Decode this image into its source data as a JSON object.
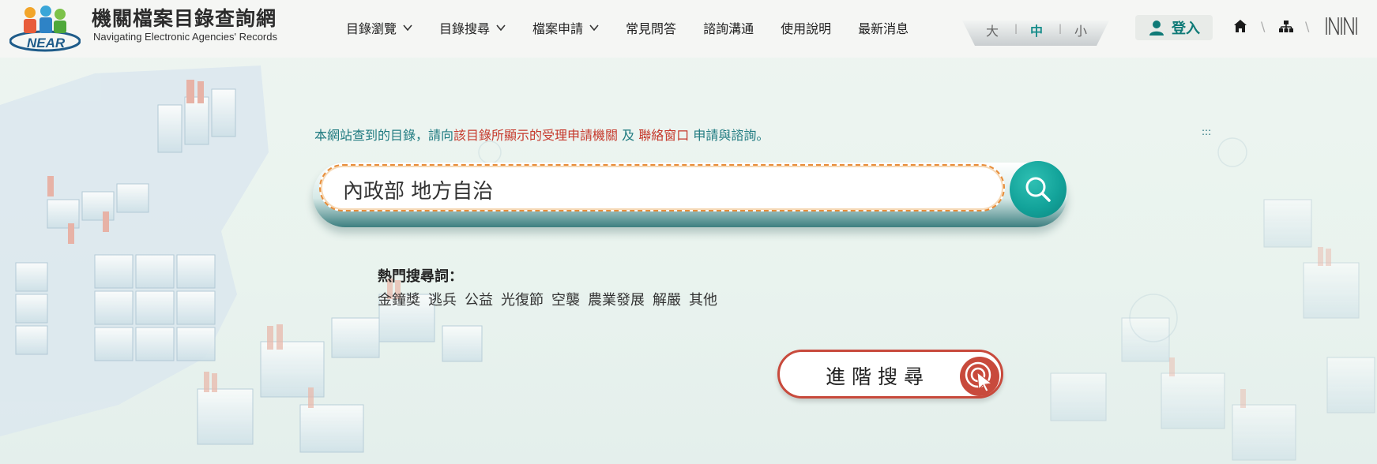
{
  "header": {
    "logo_text": "NEAR",
    "site_title": "機關檔案目錄查詢網",
    "site_subtitle": "Navigating Electronic Agencies' Records",
    "nav": [
      {
        "label": "目錄瀏覽",
        "has_dropdown": true
      },
      {
        "label": "目錄搜尋",
        "has_dropdown": true
      },
      {
        "label": "檔案申請",
        "has_dropdown": true
      },
      {
        "label": "常見問答",
        "has_dropdown": false
      },
      {
        "label": "諮詢溝通",
        "has_dropdown": false
      },
      {
        "label": "使用說明",
        "has_dropdown": false
      },
      {
        "label": "最新消息",
        "has_dropdown": false
      }
    ],
    "font_size": {
      "large": "大",
      "medium": "中",
      "small": "小",
      "active": "medium"
    },
    "login_label": "登入",
    "icons": [
      "home-icon",
      "sitemap-icon",
      "nara-logo-icon"
    ]
  },
  "notice": {
    "part1": "本網站查到的目錄，請向",
    "part2": "該目錄所顯示的受理申請機關",
    "part3": "及",
    "part4": "聯絡窗口",
    "part5": "申請與諮詢。",
    "marker": ":::"
  },
  "search": {
    "value": "內政部 地方自治",
    "button_icon": "search-icon"
  },
  "hot": {
    "title": "熱門搜尋詞：",
    "items": [
      "金鐘獎",
      "逃兵",
      "公益",
      "光復節",
      "空襲",
      "農業發展",
      "解嚴",
      "其他"
    ]
  },
  "advanced": {
    "label": "進階搜尋",
    "icon": "cursor-click-icon"
  },
  "colors": {
    "teal": "#1f7a80",
    "red": "#c6392c",
    "search_button": "#13a39a",
    "input_border": "#e88d3a"
  }
}
